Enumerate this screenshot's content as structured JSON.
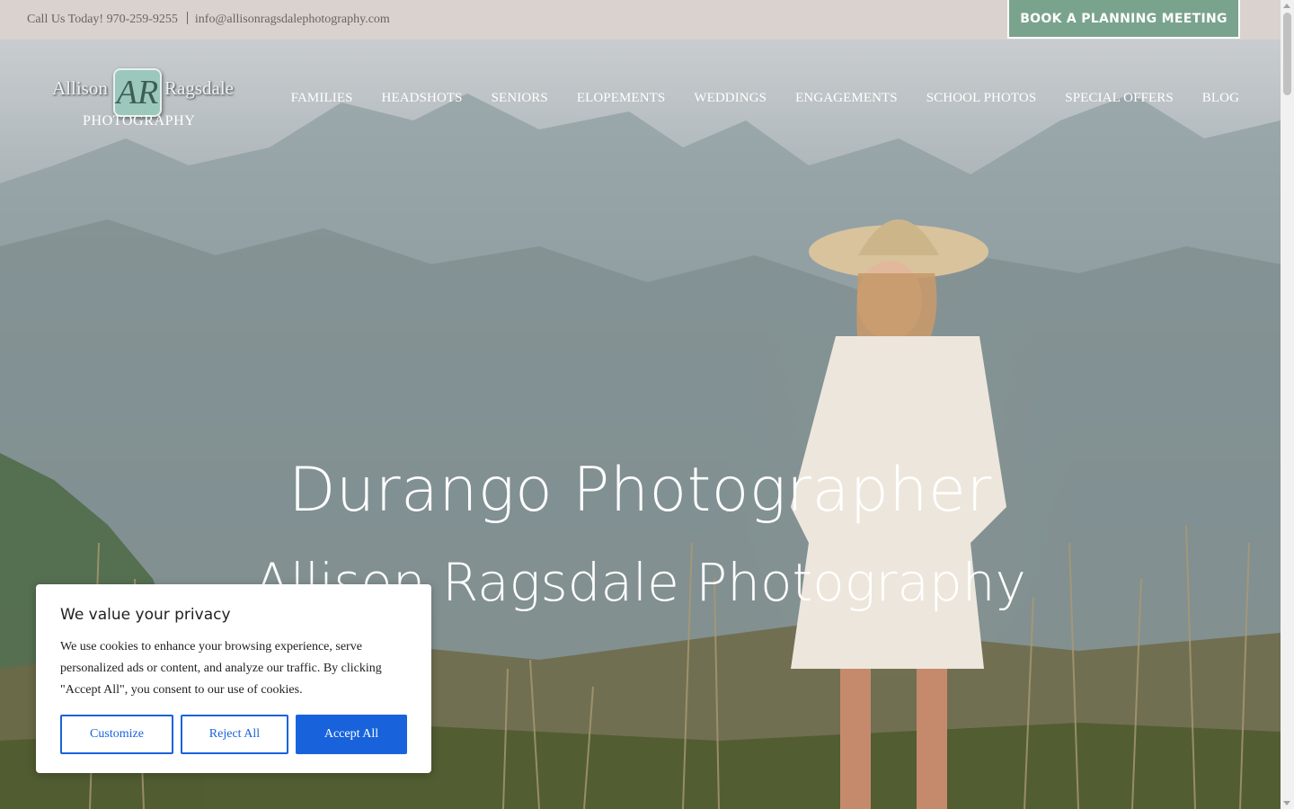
{
  "topbar": {
    "phone_text": "Call Us Today! 970-259-9255",
    "email_text": "info@allisonragsdalephotography.com",
    "book_button": "BOOK A PLANNING MEETING"
  },
  "logo": {
    "first_name": "Allison",
    "last_name": "Ragsdale",
    "monogram": "AR",
    "subtitle": "PHOTOGRAPHY"
  },
  "nav": {
    "items": [
      "FAMILIES",
      "HEADSHOTS",
      "SENIORS",
      "ELOPEMENTS",
      "WEDDINGS",
      "ENGAGEMENTS",
      "SCHOOL PHOTOS",
      "SPECIAL OFFERS",
      "BLOG"
    ]
  },
  "hero": {
    "heading": "Durango Photographer",
    "subheading": "Allison Ragsdale Photography"
  },
  "cookie": {
    "title": "We value your privacy",
    "body": "We use cookies to enhance your browsing experience, serve personalized ads or content, and analyze our traffic. By clicking \"Accept All\", you consent to our use of cookies.",
    "customize": "Customize",
    "reject": "Reject All",
    "accept": "Accept All"
  },
  "colors": {
    "topbar_bg": "#d9d2cf",
    "book_button_bg": "#7aa38e",
    "cookie_accent": "#1863dc"
  }
}
